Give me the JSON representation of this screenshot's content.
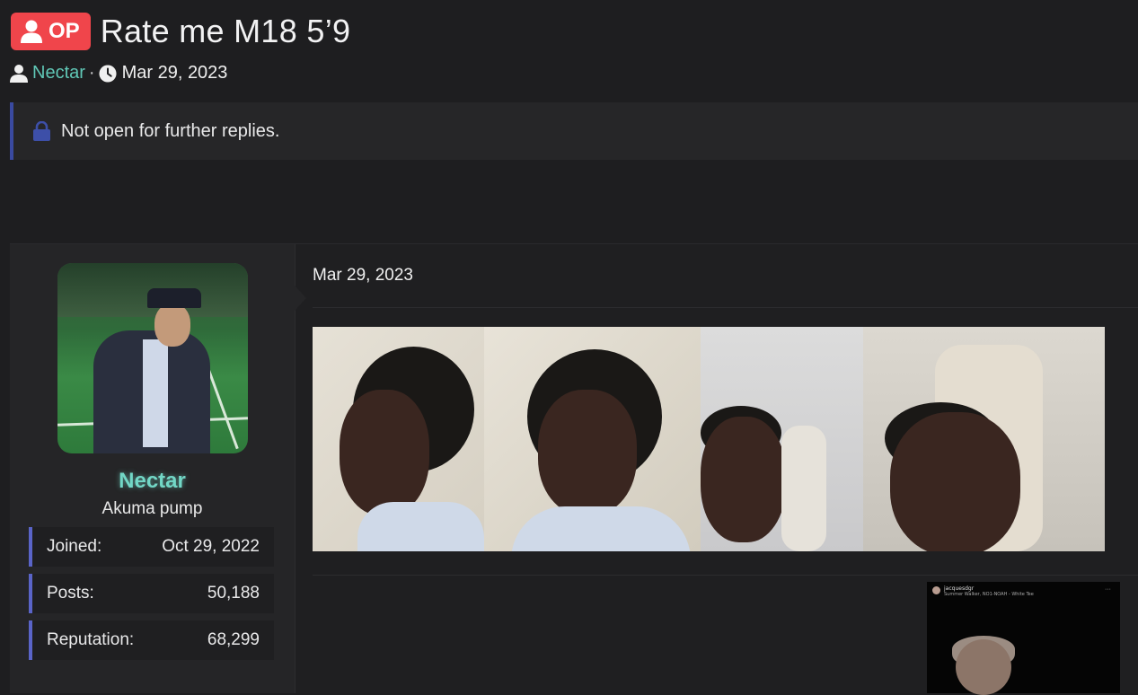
{
  "thread": {
    "op_label": "OP",
    "title": "Rate me M18 5’9",
    "author": "Nectar",
    "separator": "·",
    "date": "Mar 29, 2023"
  },
  "notice": {
    "text": "Not open for further replies."
  },
  "post": {
    "date": "Mar 29, 2023",
    "user": {
      "name": "Nectar",
      "title": "Akuma pump",
      "stats": [
        {
          "label": "Joined:",
          "value": "Oct 29, 2022"
        },
        {
          "label": "Posts:",
          "value": "50,188"
        },
        {
          "label": "Reputation:",
          "value": "68,299"
        }
      ]
    },
    "embed": {
      "username": "jacquesdgr",
      "song": "Summer Walker, NO1-NOAH - White Tee"
    }
  },
  "colors": {
    "op_badge": "#f0454b",
    "username": "#72d7c6",
    "stat_accent": "#5a64c8",
    "notice_accent": "#3a4aa0"
  },
  "icons": [
    "user-icon",
    "clock-icon",
    "lock-icon"
  ]
}
